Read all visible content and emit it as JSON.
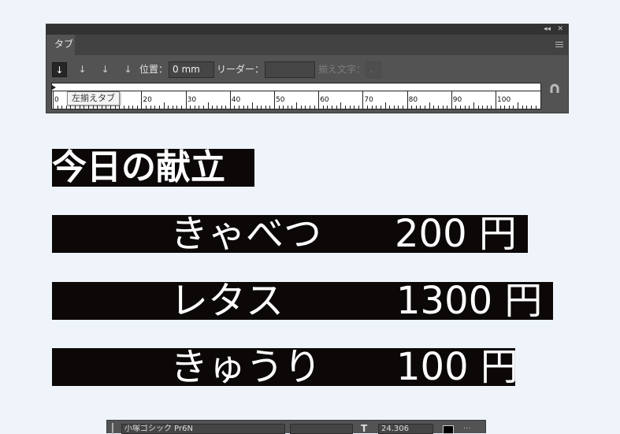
{
  "tabs_panel": {
    "tab_label": "タブ",
    "collapse_glyph": "◂◂",
    "close_glyph": "✕",
    "position_label": "位置：",
    "position_value": "0 mm",
    "leader_label": "リーダー：",
    "leader_value": "",
    "align_on_label": "揃え文字：",
    "align_on_value": ".",
    "tooltip": "左揃えタブ",
    "ruler_labels": [
      "0",
      "20",
      "30",
      "40",
      "50",
      "60",
      "70",
      "80",
      "90",
      "100"
    ]
  },
  "document": {
    "heading": "今日の献立",
    "items": [
      {
        "name": "きゃべつ",
        "price": "200 円"
      },
      {
        "name": "レタス",
        "price": "1300 円"
      },
      {
        "name": "きゅうり",
        "price": "100 円"
      }
    ]
  },
  "control_bar": {
    "font_name": "小塚ゴシック Pr6N",
    "size_value": "24.306"
  },
  "colors": {
    "panel_bg": "#535353",
    "text_highlight_bg": "#0c0808",
    "page_bg": "#eef4f9"
  },
  "icons": [
    "left-tab-icon",
    "center-tab-icon",
    "right-tab-icon",
    "decimal-tab-icon",
    "menu-icon",
    "magnet-icon",
    "font-size-icon"
  ]
}
